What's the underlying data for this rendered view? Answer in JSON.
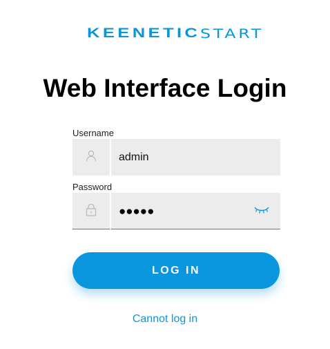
{
  "logo": {
    "brand": "KEENETIC",
    "product": "START"
  },
  "title": "Web Interface Login",
  "username": {
    "label": "Username",
    "value": "admin"
  },
  "password": {
    "label": "Password",
    "value": "●●●●●"
  },
  "login_button": "LOG IN",
  "cant_login_link": "Cannot log in",
  "colors": {
    "accent": "#0a96dc",
    "field_background": "#ececec"
  },
  "icons": {
    "username": "user-icon",
    "password": "lock-icon",
    "toggle_password": "eye-closed-icon"
  }
}
